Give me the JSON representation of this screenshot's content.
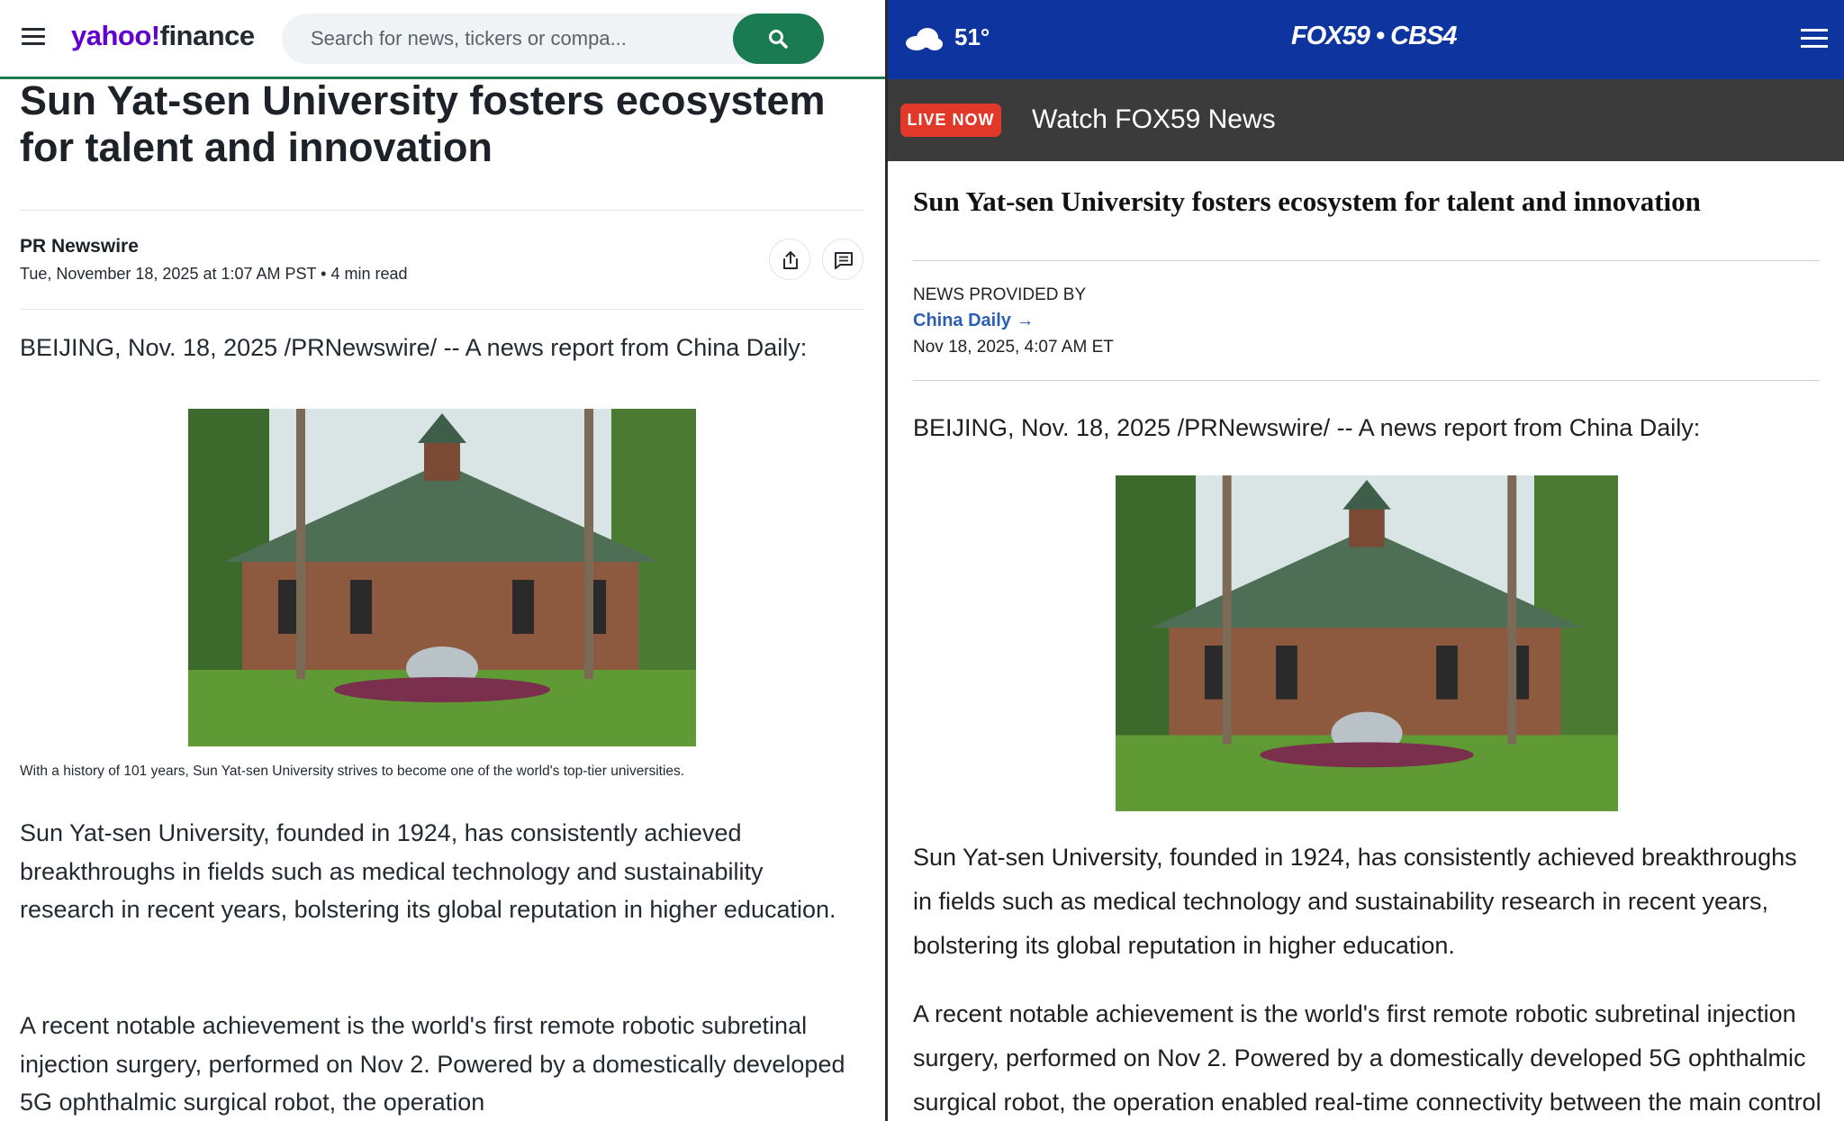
{
  "yahoo": {
    "logo": {
      "brand": "yahoo!",
      "product": "finance"
    },
    "search": {
      "placeholder": "Search for news, tickers or compa..."
    },
    "article": {
      "title": "Sun Yat-sen University fosters ecosystem for talent and innovation",
      "source": "PR Newswire",
      "date_line": "Tue, November 18, 2025 at 1:07 AM PST • 4 min read",
      "lede": "BEIJING, Nov. 18, 2025 /PRNewswire/ -- A news report from China Daily:",
      "caption": "With a history of 101 years, Sun Yat-sen University strives to become one of the world's top-tier universities.",
      "paragraph1": "Sun Yat-sen University, founded in 1924, has consistently achieved breakthroughs in fields such as medical technology and sustainability research in recent years, bolstering its global reputation in higher education.",
      "paragraph2": "A recent notable achievement is the world's first remote robotic subretinal injection surgery, performed on Nov 2. Powered by a domestically developed 5G ophthalmic surgical robot, the operation"
    },
    "colors": {
      "accent": "#1a7a52",
      "brand": "#6001d2"
    }
  },
  "fox": {
    "weather": {
      "temp": "51°",
      "icon": "cloud-icon"
    },
    "logo": "FOX59 • CBS4",
    "live": {
      "badge": "LIVE NOW",
      "text": "Watch FOX59 News"
    },
    "article": {
      "title": "Sun Yat-sen University fosters ecosystem for talent and innovation",
      "provided_by": "NEWS PROVIDED BY",
      "provider": "China Daily →",
      "date": "Nov 18, 2025, 4:07 AM ET",
      "lede": "BEIJING, Nov. 18, 2025 /PRNewswire/ -- A news report from China Daily:",
      "paragraph1": "Sun Yat-sen University, founded in 1924, has consistently achieved breakthroughs in fields such as medical technology and sustainability research in recent years, bolstering its global reputation in higher education.",
      "paragraph2": "A recent notable achievement is the world's first remote robotic subretinal injection surgery, performed on Nov 2. Powered by a domestically developed 5G ophthalmic surgical robot, the operation enabled real-time connectivity between the main control"
    },
    "colors": {
      "header": "#0e34a0",
      "live_badge": "#e2382a",
      "link": "#2b5fb4"
    }
  }
}
